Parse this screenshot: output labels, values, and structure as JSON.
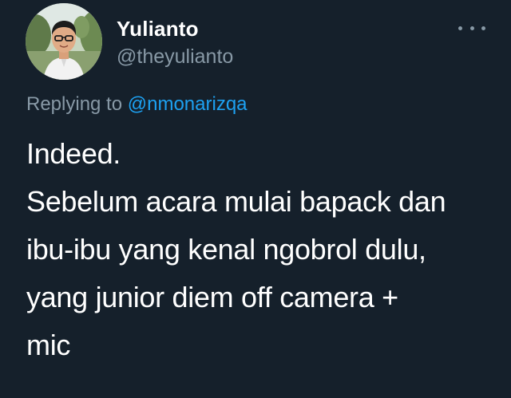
{
  "author": {
    "display_name": "Yulianto",
    "handle": "@theyulianto",
    "avatar_icon": "profile-photo"
  },
  "reply": {
    "prefix": "Replying to",
    "mention": "@nmonarizqa"
  },
  "tweet": {
    "lines": [
      "Indeed.",
      "Sebelum acara mulai bapack dan",
      "ibu-ibu yang kenal ngobrol dulu,",
      "yang junior diem off camera +",
      "mic"
    ]
  },
  "menu": {
    "icon": "more-horizontal-icon"
  },
  "colors": {
    "background": "#15202b",
    "secondary_text": "#8899a6",
    "accent": "#1da1f2"
  }
}
